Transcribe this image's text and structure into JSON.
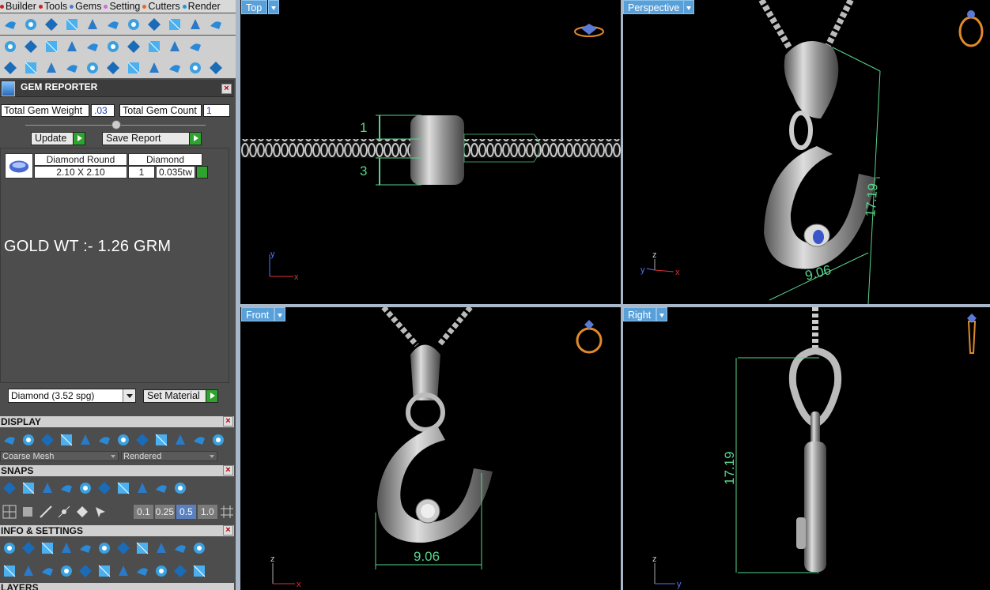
{
  "menu": {
    "items": [
      {
        "label": "Builder",
        "dot": "#c22"
      },
      {
        "label": "Tools",
        "dot": "#c22"
      },
      {
        "label": "Gems",
        "dot": "#4a7ad8"
      },
      {
        "label": "Setting",
        "dot": "#d56ad8"
      },
      {
        "label": "Cutters",
        "dot": "#e86a1a"
      },
      {
        "label": "Render",
        "dot": "#1a9ad8"
      }
    ]
  },
  "toolbar": {
    "row1": [
      "gem-tool-1-icon",
      "gem-tool-2-icon",
      "gem-tool-3-icon",
      "gem-tool-4-icon",
      "gem-tool-5-icon",
      "gem-tool-6-icon",
      "gem-tool-7-icon",
      "gem-tool-8-icon",
      "gem-tool-9-icon",
      "gem-tool-10-icon",
      "gem-tool-11-icon"
    ],
    "row2": [
      "gem-tool-12-icon",
      "diamond-icon",
      "gem-tool-13-icon",
      "gem-tool-14-icon",
      "gem-tool-15-icon",
      "gem-tool-16-icon",
      "gem-tool-17-icon",
      "gem-tool-18-icon",
      "gem-tool-19-icon",
      "gem-tool-20-icon"
    ],
    "row3": [
      "boolean-icon",
      "curve-icon",
      "pipe-icon",
      "extrude-icon",
      "move-icon",
      "rotate-icon",
      "mirror-icon",
      "array-icon",
      "split-icon",
      "copy-icon",
      "circle-icon"
    ]
  },
  "gem_reporter": {
    "title": "GEM REPORTER",
    "total_weight_label": "Total Gem Weight",
    "total_weight_value": ".03",
    "total_count_label": "Total Gem Count",
    "total_count_value": "1",
    "update_label": "Update",
    "save_report_label": "Save Report",
    "table": {
      "header_shape": "Diamond Round",
      "header_material": "Diamond",
      "size": "2.10 X 2.10",
      "count": "1",
      "weight": "0.035tw"
    }
  },
  "gold_weight": "GOLD WT :- 1.26 GRM",
  "material": {
    "selected": "Diamond    (3.52 spg)",
    "set_label": "Set Material"
  },
  "display": {
    "title": "DISPLAY",
    "mesh_option": "Coarse Mesh",
    "render_option": "Rendered"
  },
  "snaps": {
    "title": "SNAPS",
    "values": [
      "0.1",
      "0.25",
      "0.5",
      "1.0"
    ],
    "active": "0.5"
  },
  "info": {
    "title": "INFO & SETTINGS"
  },
  "layers": {
    "title": "LAYERS"
  },
  "viewports": {
    "top": {
      "label": "Top",
      "dim1": "1",
      "dim2": "3"
    },
    "perspective": {
      "label": "Perspective",
      "dim_width": "9.06",
      "dim_height": "17.19"
    },
    "front": {
      "label": "Front",
      "dim_width": "9.06"
    },
    "right": {
      "label": "Right",
      "dim_height": "17.19"
    }
  },
  "axes": {
    "x": "x",
    "y": "y",
    "z": "z"
  },
  "colors": {
    "accent": "#5aa0d8",
    "dimension": "#58d48a",
    "panel": "#4d4d4d",
    "axis_x": "#d33",
    "axis_y": "#5577ff"
  }
}
